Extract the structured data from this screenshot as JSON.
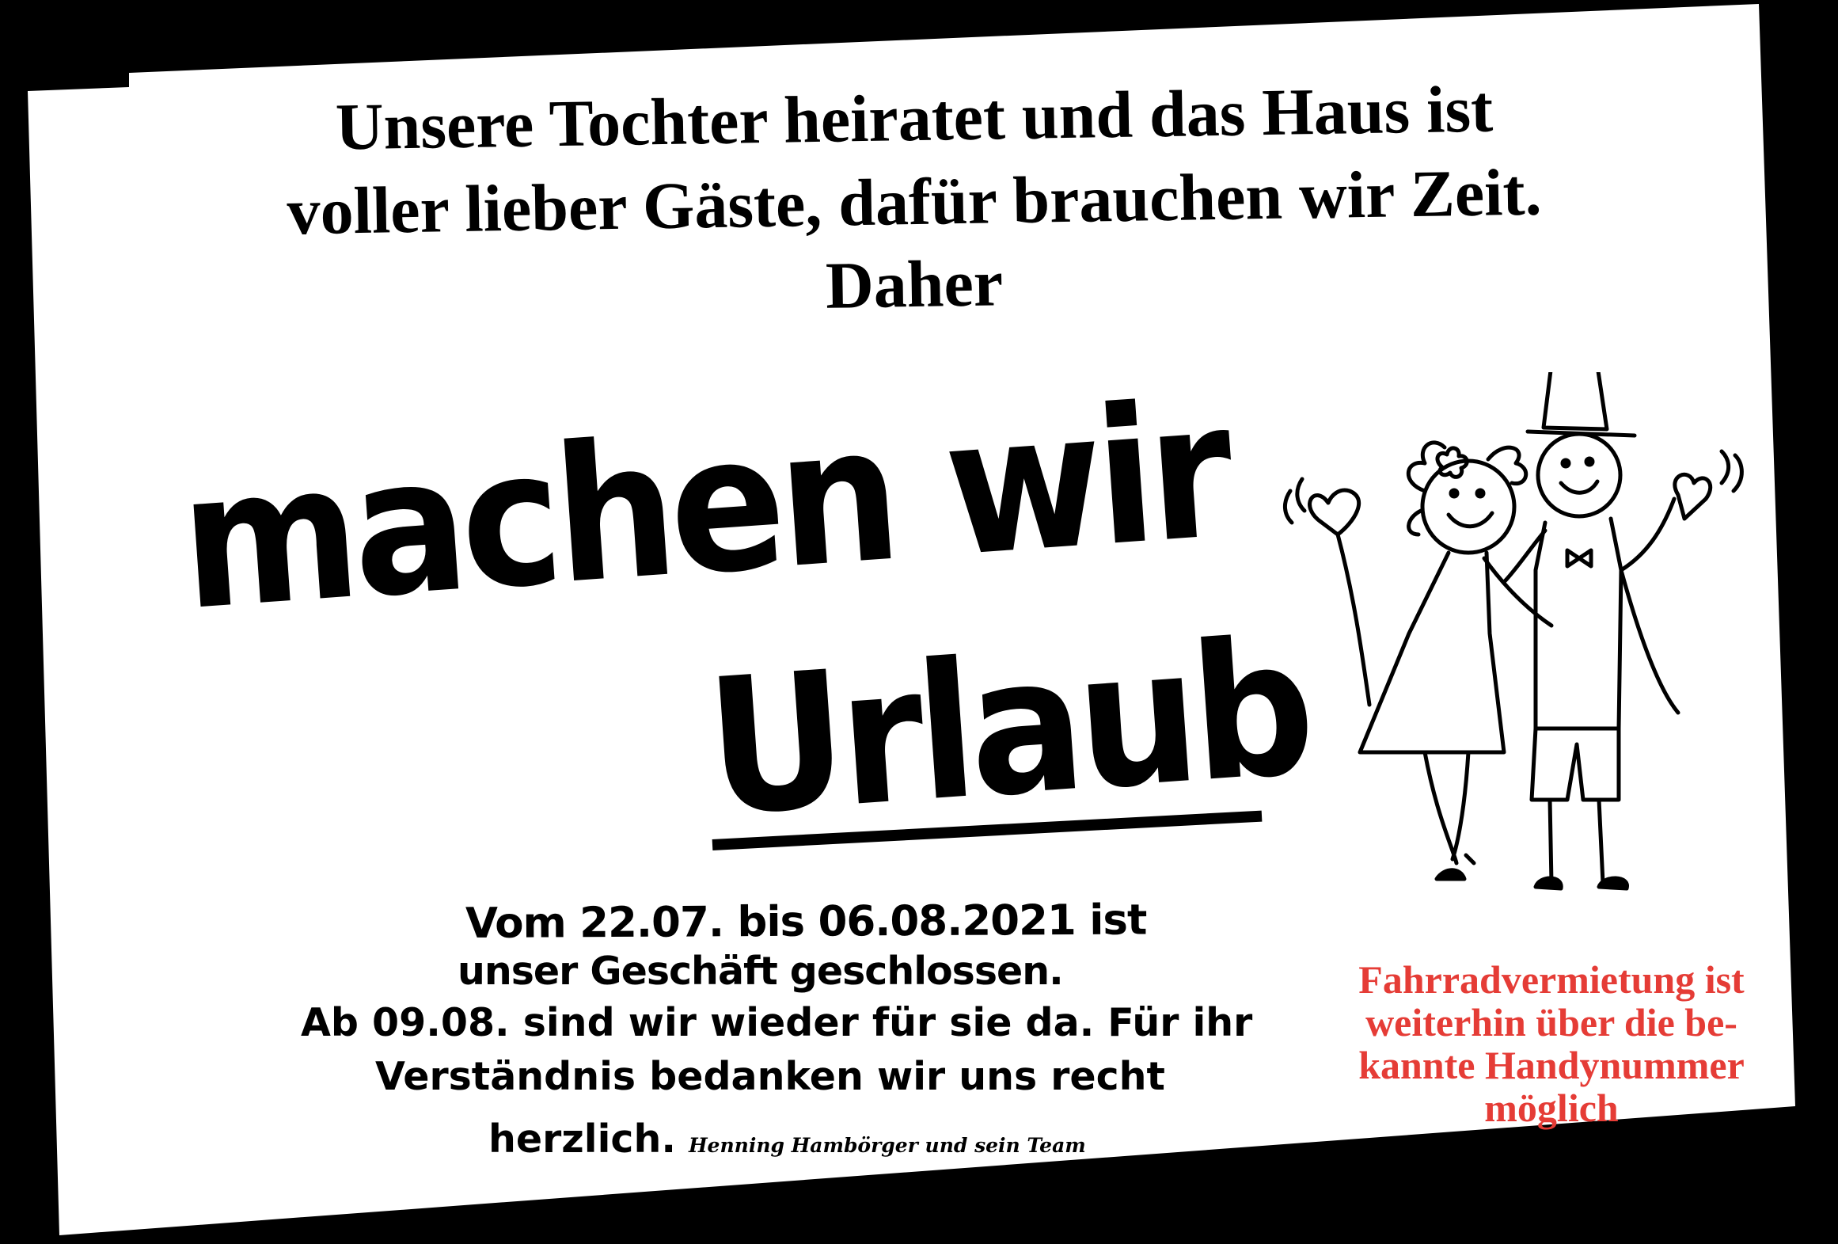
{
  "headline": {
    "line1": "Unsere Tochter heiratet und das Haus ist",
    "line2": "voller lieber Gäste, dafür brauchen wir Zeit.",
    "line3": "Daher"
  },
  "slogan": {
    "line1": "machen wir",
    "line2": "Urlaub"
  },
  "closure": {
    "line1": "Vom 22.07. bis 06.08.2021 ist",
    "line2": "unser Geschäft geschlossen.",
    "line3": "Ab 09.08. sind wir wieder für sie da. Für ihr",
    "line4": "Verständnis bedanken wir uns recht",
    "line5": "herzlich.",
    "signature": "Henning Hambörger und sein Team"
  },
  "bike_note": {
    "line1": "Fahrradvermietung  ist",
    "line2": "weiterhin über die be-",
    "line3": "kannte Handynummer",
    "line4": "möglich",
    "color": "#e53c36"
  },
  "illustration": "bride-and-groom-drawing"
}
